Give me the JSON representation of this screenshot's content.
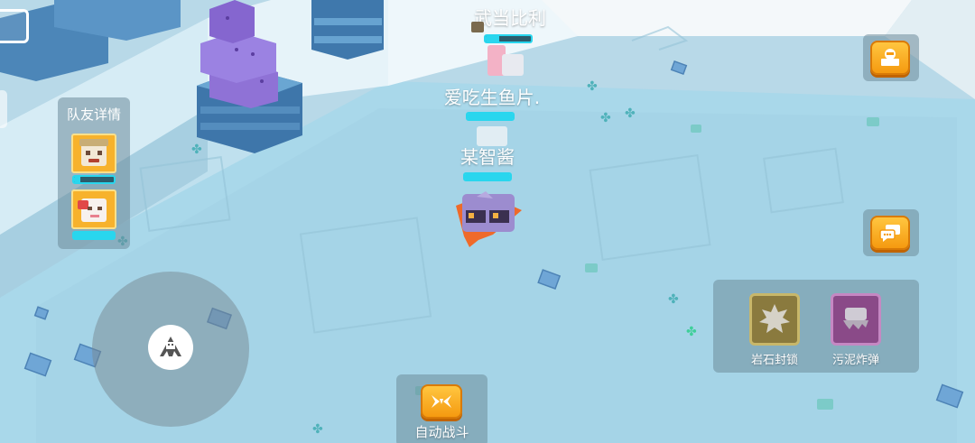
{
  "team_panel": {
    "title": "队友详情",
    "members": [
      {
        "icon": "teammate-avatar-icon",
        "hp_fraction": 0.15,
        "hp_color": "#29d6ee",
        "alt_color": "#7bc21e"
      },
      {
        "icon": "teammate-avatar-icon",
        "hp_fraction": 1.0,
        "hp_color": "#29d6ee"
      }
    ]
  },
  "players": [
    {
      "name": "武当比利",
      "hp_fraction": 0.3
    },
    {
      "name": "爱吃生鱼片.",
      "hp_fraction": 1.0
    },
    {
      "name": "某智酱",
      "hp_fraction": 1.0
    }
  ],
  "skills": [
    {
      "label": "岩石封锁",
      "icon": "rock-tomb-icon",
      "color": "#8a7a3e"
    },
    {
      "label": "污泥炸弹",
      "icon": "sludge-bomb-icon",
      "color": "#8a4a88"
    }
  ],
  "auto_battle": {
    "label": "自动战斗"
  },
  "side_buttons": [
    {
      "icon": "pokemon-storage-icon"
    },
    {
      "icon": "chat-icon"
    }
  ],
  "colors": {
    "ground": "#bfe0ee",
    "accent_orange": "#f59a10",
    "hp_cyan": "#29d6ee",
    "pointer": "#ef6a2a"
  }
}
